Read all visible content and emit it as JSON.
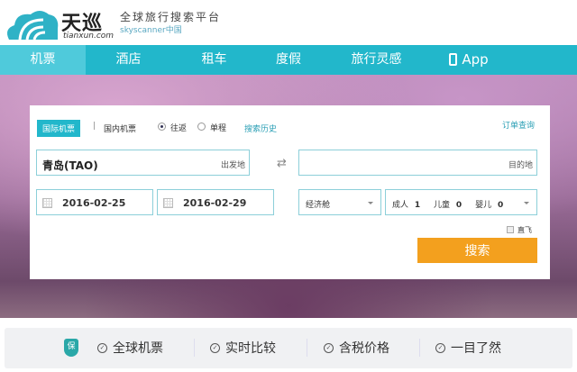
{
  "logo": {
    "name": "天巡",
    "domain": "tianxun.com",
    "slogan": "全球旅行搜索平台",
    "sub": "skyscanner中国"
  },
  "nav": [
    {
      "label": "机票",
      "active": true
    },
    {
      "label": "酒店"
    },
    {
      "label": "租车"
    },
    {
      "label": "度假"
    },
    {
      "label": "旅行灵感"
    },
    {
      "label": "App",
      "icon": "phone-icon"
    }
  ],
  "form": {
    "tab_intl": "国际机票",
    "separator": "|",
    "tab_domestic": "国内机票",
    "trip_round": "往返",
    "trip_oneway": "单程",
    "trip_selected": "往返",
    "history": "搜索历史",
    "order_lookup": "订单查询",
    "origin_value": "青岛(TAO)",
    "origin_hint": "出发地",
    "destination_value": "",
    "destination_hint": "目的地",
    "depart_date": "2016-02-25",
    "return_date": "2016-02-29",
    "cabin": "经济舱",
    "adult_label": "成人",
    "adult_count": "1",
    "child_label": "儿童",
    "child_count": "0",
    "infant_label": "婴儿",
    "infant_count": "0",
    "direct_label": "直飞",
    "direct_checked": false,
    "search": "搜索"
  },
  "features": {
    "badge": "保",
    "items": [
      "全球机票",
      "实时比较",
      "含税价格",
      "一目了然"
    ]
  },
  "colors": {
    "accent": "#22b7cb",
    "button": "#f3a01e"
  }
}
